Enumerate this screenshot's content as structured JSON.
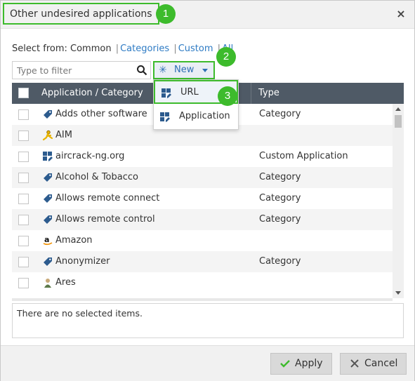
{
  "dialog": {
    "title": "Other undesired applications",
    "close_symbol": "×"
  },
  "callouts": [
    "1",
    "2",
    "3"
  ],
  "select_from": {
    "prefix": "Select from:",
    "common": "Common",
    "categories": "Categories",
    "custom": "Custom",
    "all": "All",
    "separator": "|"
  },
  "filter": {
    "placeholder": "Type to filter",
    "value": ""
  },
  "new_button": {
    "star": "✳",
    "label": "New"
  },
  "dropdown": {
    "items": [
      {
        "label": "URL",
        "icon": "url-icon"
      },
      {
        "label": "Application",
        "icon": "application-icon"
      }
    ]
  },
  "table": {
    "columns": [
      "Application / Category",
      "Type"
    ],
    "rows": [
      {
        "name": "Adds other software",
        "type": "Category",
        "icon": "tag-icon"
      },
      {
        "name": "AIM",
        "type": "",
        "icon": "aim-icon"
      },
      {
        "name": "aircrack-ng.org",
        "type": "Custom Application",
        "icon": "custom-app-icon"
      },
      {
        "name": "Alcohol & Tobacco",
        "type": "Category",
        "icon": "tag-icon"
      },
      {
        "name": "Allows remote connect",
        "type": "Category",
        "icon": "tag-icon"
      },
      {
        "name": "Allows remote control",
        "type": "Category",
        "icon": "tag-icon"
      },
      {
        "name": "Amazon",
        "type": "",
        "icon": "amazon-icon"
      },
      {
        "name": "Anonymizer",
        "type": "Category",
        "icon": "tag-icon"
      },
      {
        "name": "Ares",
        "type": "",
        "icon": "ares-icon"
      }
    ]
  },
  "selected": {
    "empty_text": "There are no selected items."
  },
  "footer": {
    "apply_label": "Apply",
    "cancel_label": "Cancel"
  },
  "colors": {
    "highlight_green": "#3dbb2c",
    "link_blue": "#2e7bc4",
    "header_bg": "#4f5a66",
    "tag_blue": "#2c5b8e"
  }
}
